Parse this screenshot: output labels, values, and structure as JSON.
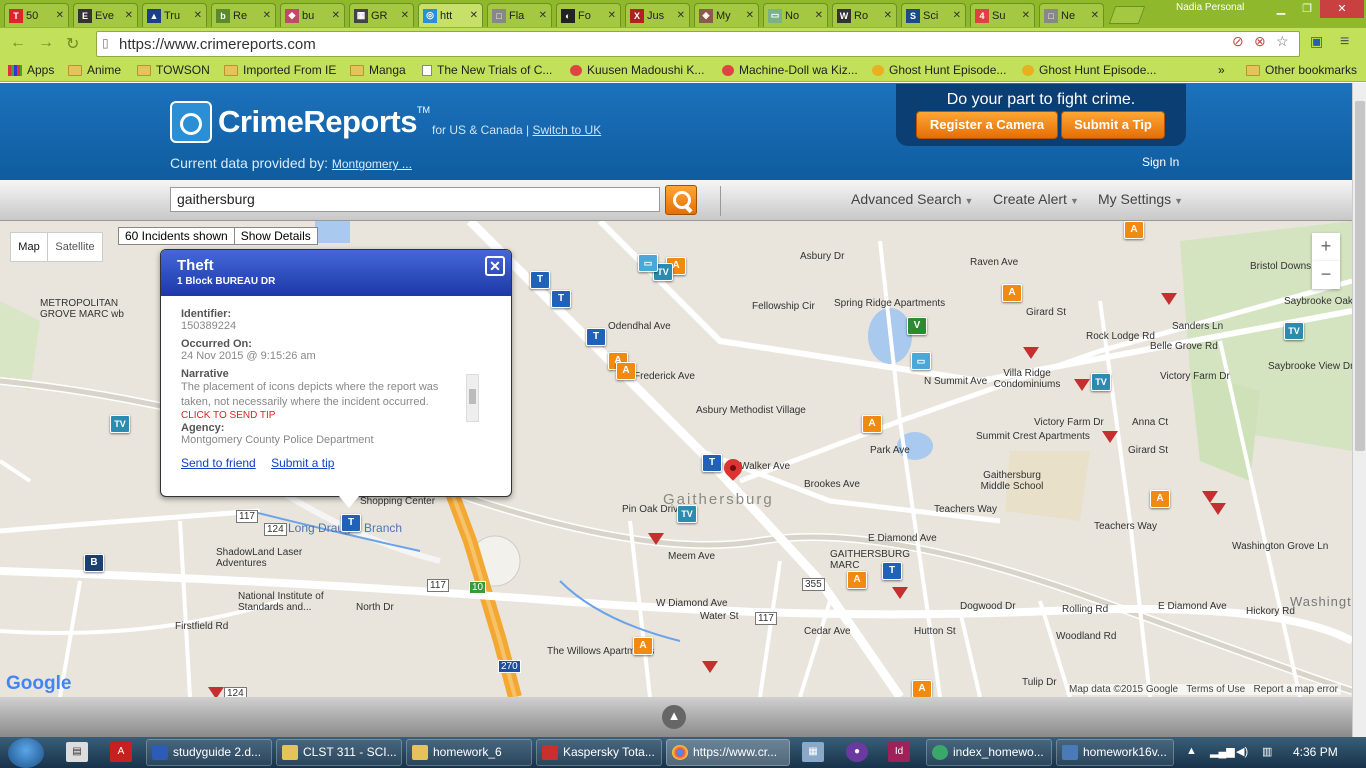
{
  "browser": {
    "tabs": [
      {
        "label": "50",
        "icon": "T",
        "color": "#d9262c"
      },
      {
        "label": "Eve",
        "icon": "E",
        "color": "#333333"
      },
      {
        "label": "Tru",
        "icon": "▲",
        "color": "#1b3f8b"
      },
      {
        "label": "Re",
        "icon": "b",
        "color": "#5a8a2a"
      },
      {
        "label": "bu",
        "icon": "◆",
        "color": "#c04a6a"
      },
      {
        "label": "GR",
        "icon": "▦",
        "color": "#444444"
      },
      {
        "label": "htt",
        "icon": "◎",
        "color": "#2b8fd6"
      },
      {
        "label": "Fla",
        "icon": "□",
        "color": "#888888"
      },
      {
        "label": "Fo",
        "icon": "◐",
        "color": "#222222"
      },
      {
        "label": "Jus",
        "icon": "X",
        "color": "#b02222"
      },
      {
        "label": "My",
        "icon": "◈",
        "color": "#8a5a4a"
      },
      {
        "label": "No",
        "icon": "▭",
        "color": "#7ab08a"
      },
      {
        "label": "Ro",
        "icon": "W",
        "color": "#333333"
      },
      {
        "label": "Sci",
        "icon": "S",
        "color": "#1a4a8a"
      },
      {
        "label": "Su",
        "icon": "4",
        "color": "#e04040"
      },
      {
        "label": "Ne",
        "icon": "□",
        "color": "#888888"
      }
    ],
    "profile_name": "Nadia Personal",
    "url": "https://www.crimereports.com",
    "bookmarks": [
      "Apps",
      "Anime",
      "TOWSON",
      "Imported From IE",
      "Manga",
      "The New Trials of C...",
      "Kuusen Madoushi K...",
      "Machine-Doll wa Kiz...",
      "Ghost Hunt Episode...",
      "Ghost Hunt Episode...",
      "»",
      "Other bookmarks"
    ]
  },
  "site": {
    "brand": "CrimeReports",
    "trademark": "TM",
    "region_text": "for US & Canada |",
    "region_link": "Switch to UK",
    "provider_label": "Current data provided by:",
    "provider_link": "Montgomery ...",
    "promo_heading": "Do your part to fight crime.",
    "register_camera": "Register a Camera",
    "submit_tip": "Submit a Tip",
    "sign_in": "Sign In",
    "search_value": "gaithersburg",
    "menu": [
      "Advanced Search",
      "Create Alert",
      "My Settings"
    ]
  },
  "map": {
    "type_map": "Map",
    "type_satellite": "Satellite",
    "incidents_shown": "60 Incidents shown",
    "show_details": "Show Details",
    "zoom_in": "+",
    "zoom_out": "−",
    "city_label": "Gaithersburg",
    "labels": [
      "METROPOLITAN GROVE MARC wb",
      "Spring Ridge Apartments",
      "Raven Ave",
      "Bristol Downs",
      "Saybrooke Oaks Blvd",
      "Villa Ridge Condominiums",
      "Asbury Methodist Village",
      "Victory Farm Dr",
      "Summit Crest Apartments",
      "Gaithersburg Middle School",
      "Teachers Way",
      "Teachers Way",
      "Brookes Ave",
      "Walker Ave",
      "E Diamond Ave",
      "W Diamond Ave",
      "GAITHERSBURG MARC",
      "Shopping Center",
      "Long Draught Branch",
      "ShadowLand Laser Adventures",
      "National Institute of Standards and...",
      "North Dr",
      "The Willows Apartments",
      "Hutton St",
      "Rolling Rd",
      "Tulip Dr",
      "Pin Oak Drive",
      "Meem Ave",
      "Firstfield Rd",
      "Odendhal Ave",
      "Fellowship Cir",
      "Asbury Dr",
      "Girard St",
      "Rock Lodge Rd",
      "N Summit Ave",
      "Park Ave",
      "Washington Grove Ln",
      "Hickory Rd",
      "Cedar Ave",
      "Dogwood Dr",
      "Woodland Rd",
      "Water St",
      "Girard St",
      "Anna Ct",
      "Sanders Ln",
      "Belle Grove Rd",
      "Victory Farm Dr",
      "Saybrooke View Dr",
      "Frederick Ave",
      "Washington Gro...",
      "E Diamond Ave"
    ],
    "attribution": [
      "Map data ©2015 Google",
      "Terms of Use",
      "Report a map error"
    ],
    "google_logo": "Google",
    "route_shields": [
      "117",
      "124",
      "117",
      "10",
      "117",
      "355",
      "270",
      "124"
    ]
  },
  "popup": {
    "title": "Theft",
    "address": "1 Block BUREAU DR",
    "identifier_label": "Identifier:",
    "identifier": "150389224",
    "occurred_label": "Occurred On:",
    "occurred": "24 Nov 2015 @ 9:15:26 am",
    "narrative_label": "Narrative",
    "narrative": "The placement of icons depicts where the report was taken, not necessarily where the incident occurred.",
    "click_to_send": "CLICK TO SEND TIP",
    "agency_label": "Agency:",
    "agency": "Montgomery County Police Department",
    "send_friend": "Send to friend",
    "submit_tip": "Submit a tip"
  },
  "taskbar": {
    "tasks": [
      "studyguide 2.d...",
      "CLST 311 - SCI...",
      "homework_6",
      "Kaspersky Tota...",
      "https://www.cr...",
      "index_homewo...",
      "homework16v..."
    ],
    "clock": "4:36 PM"
  }
}
